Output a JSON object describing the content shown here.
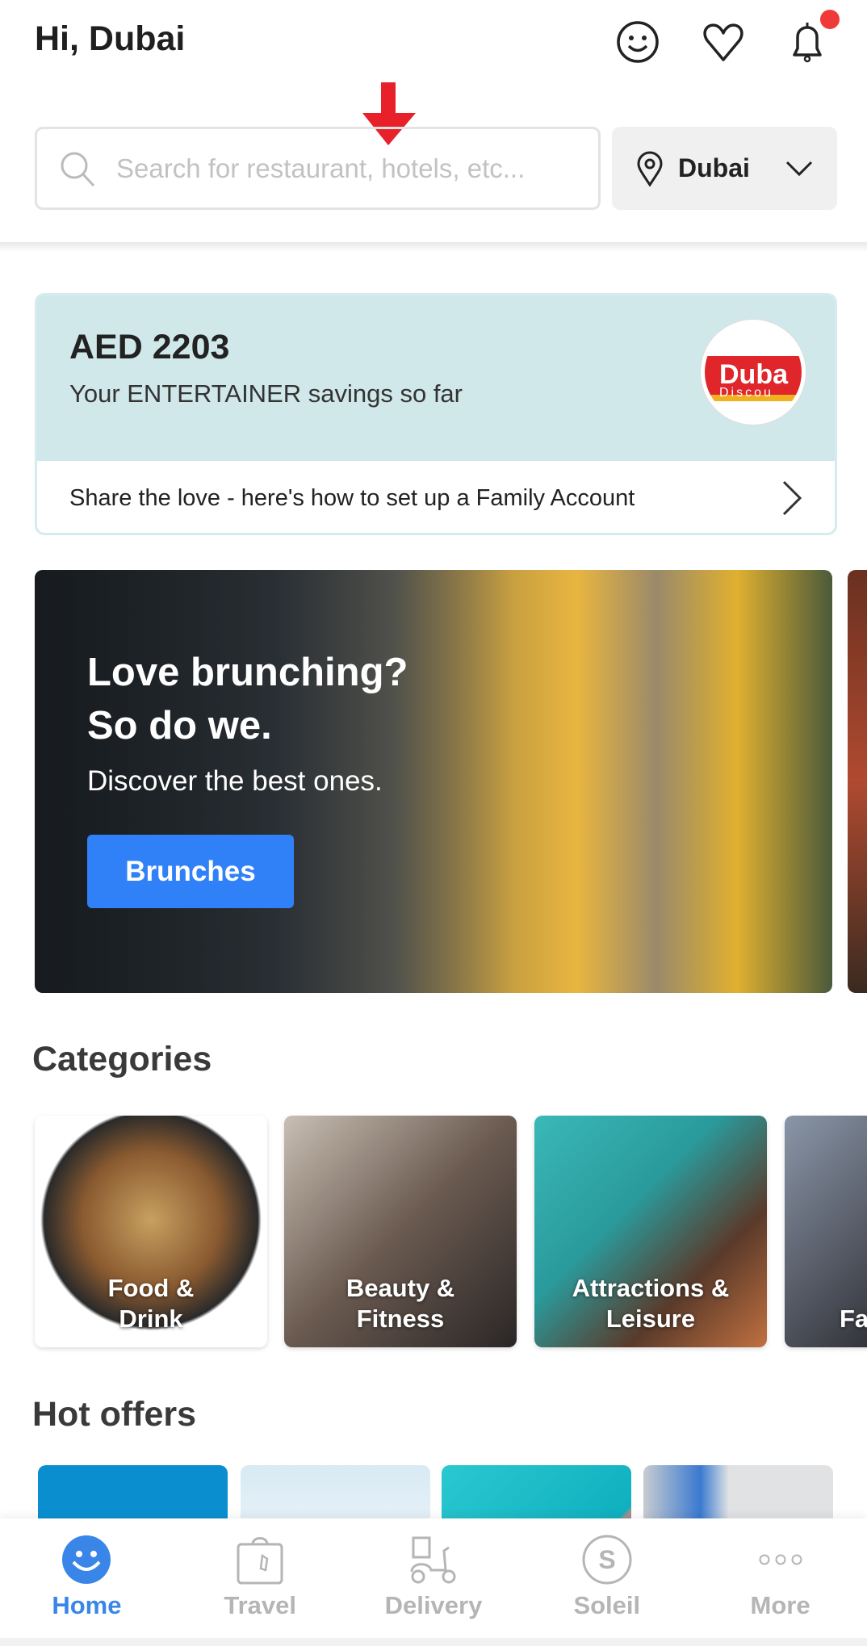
{
  "header": {
    "greeting": "Hi, Dubai",
    "icons": [
      "smiley-icon",
      "heart-icon",
      "bell-icon"
    ],
    "notification_dot_color": "#f03a3a"
  },
  "search": {
    "placeholder": "Search for restaurant, hotels, etc..."
  },
  "location": {
    "city": "Dubai"
  },
  "savings": {
    "amount": "AED 2203",
    "subtitle": "Your ENTERTAINER savings so far",
    "logo_text": "Dubai Discounts",
    "share_text": "Share the love - here's how to set up a Family Account"
  },
  "banner": {
    "title_line1": "Love brunching?",
    "title_line2": "So do we.",
    "subtitle": "Discover the best ones.",
    "button": "Brunches"
  },
  "categories": {
    "heading": "Categories",
    "items": [
      {
        "label": "Food &\nDrink"
      },
      {
        "label": "Beauty &\nFitness"
      },
      {
        "label": "Attractions &\nLeisure"
      },
      {
        "label": "Fa"
      }
    ]
  },
  "hot_offers": {
    "heading": "Hot offers"
  },
  "nav": {
    "items": [
      {
        "label": "Home",
        "icon": "smiley-icon"
      },
      {
        "label": "Travel",
        "icon": "travel-bag-icon"
      },
      {
        "label": "Delivery",
        "icon": "scooter-icon"
      },
      {
        "label": "Soleil",
        "icon": "soleil-s-icon"
      },
      {
        "label": "More",
        "icon": "more-dots-icon"
      }
    ]
  },
  "colors": {
    "accent": "#3081f7",
    "nav_active": "#3a86e8",
    "card_bg": "#d1e8ea",
    "arrow": "#e8202a"
  }
}
